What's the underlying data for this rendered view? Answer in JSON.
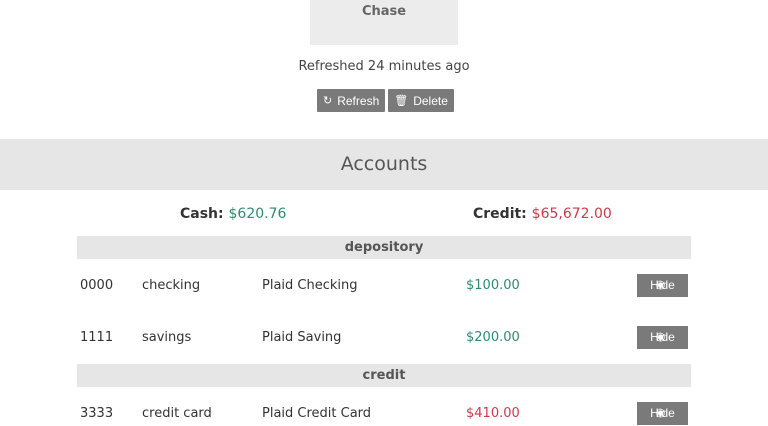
{
  "institution": {
    "name": "Chase",
    "refreshed_text": "Refreshed 24 minutes ago",
    "refresh_label": "Refresh",
    "delete_label": "Delete"
  },
  "accounts": {
    "title": "Accounts",
    "cash_label": "Cash:",
    "cash_value": "$620.76",
    "credit_label": "Credit:",
    "credit_value": "$65,672.00",
    "hide_label": "Hide",
    "groups": [
      {
        "name": "depository",
        "rows": [
          {
            "mask": "0000",
            "subtype": "checking",
            "name": "Plaid Checking",
            "balance": "$100.00"
          },
          {
            "mask": "1111",
            "subtype": "savings",
            "name": "Plaid Saving",
            "balance": "$200.00"
          }
        ]
      },
      {
        "name": "credit",
        "rows": [
          {
            "mask": "3333",
            "subtype": "credit card",
            "name": "Plaid Credit Card",
            "balance": "$410.00"
          }
        ]
      }
    ]
  },
  "colors": {
    "positive": "#2e8b6e",
    "negative": "#d2384a",
    "button": "#7a7a7a"
  },
  "icons": {
    "refresh": "refresh-icon",
    "delete": "trash-icon",
    "hide": "eye-slash-icon"
  }
}
